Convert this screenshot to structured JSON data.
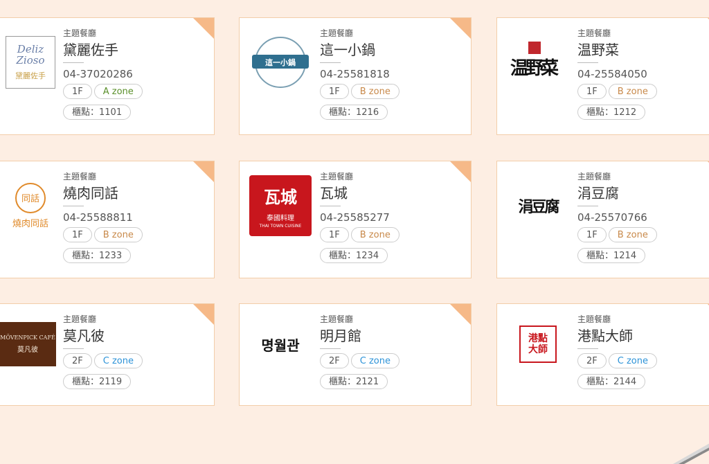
{
  "shops": [
    {
      "category": "主題餐廳",
      "name": "黛麗佐手",
      "phone": "04-37020286",
      "floor": "1F",
      "zone": "A zone",
      "zone_class": "zone-a",
      "location": "櫃點：1101",
      "logo": {
        "type": "deliziosso",
        "line1": "Deliz",
        "line2": "Zioso",
        "sub": "黛麗佐手"
      }
    },
    {
      "category": "主題餐廳",
      "name": "這一小鍋",
      "phone": "04-25581818",
      "floor": "1F",
      "zone": "B zone",
      "zone_class": "zone-b",
      "location": "櫃點：1216",
      "logo": {
        "type": "badge",
        "text": "這一小鍋"
      }
    },
    {
      "category": "主題餐廳",
      "name": "温野菜",
      "phone": "04-25584050",
      "floor": "1F",
      "zone": "B zone",
      "zone_class": "zone-b",
      "location": "櫃點：1212",
      "logo": {
        "type": "brush",
        "text": "温野菜"
      }
    },
    {
      "category": "主題餐廳",
      "name": "燒肉同話",
      "phone": "04-25588811",
      "floor": "1F",
      "zone": "B zone",
      "zone_class": "zone-b",
      "location": "櫃點：1233",
      "logo": {
        "type": "circle",
        "big": "同話",
        "sub": "燒肉同話"
      }
    },
    {
      "category": "主題餐廳",
      "name": "瓦城",
      "phone": "04-25585277",
      "floor": "1F",
      "zone": "B zone",
      "zone_class": "zone-b",
      "location": "櫃點：1234",
      "logo": {
        "type": "red",
        "big": "瓦城",
        "sub": "泰國料理",
        "sub2": "THAI TOWN CUISINE"
      }
    },
    {
      "category": "主題餐廳",
      "name": "涓豆腐",
      "phone": "04-25570766",
      "floor": "1F",
      "zone": "B zone",
      "zone_class": "zone-b",
      "location": "櫃點：1214",
      "logo": {
        "type": "brush2",
        "text": "涓豆腐"
      }
    },
    {
      "category": "主題餐廳",
      "name": "莫凡彼",
      "phone": "",
      "floor": "2F",
      "zone": "C zone",
      "zone_class": "zone-c",
      "location": "櫃點：2119",
      "logo": {
        "type": "brown",
        "line1": "MÖVENPICK CAFÉ",
        "line2": "莫凡彼"
      }
    },
    {
      "category": "主題餐廳",
      "name": "明月館",
      "phone": "",
      "floor": "2F",
      "zone": "C zone",
      "zone_class": "zone-c",
      "location": "櫃點：2121",
      "logo": {
        "type": "korean",
        "text": "명월관"
      }
    },
    {
      "category": "主題餐廳",
      "name": "港點大師",
      "phone": "",
      "floor": "2F",
      "zone": "C zone",
      "zone_class": "zone-c",
      "location": "櫃點：2144",
      "logo": {
        "type": "seal",
        "text": "港點大師"
      }
    }
  ],
  "colors": {
    "background": "#fdeee3",
    "card_border": "#f2cda9",
    "corner": "#f6b988",
    "zone_a": "#5a8f2a",
    "zone_b": "#c8894a",
    "zone_c": "#2d93d8"
  }
}
